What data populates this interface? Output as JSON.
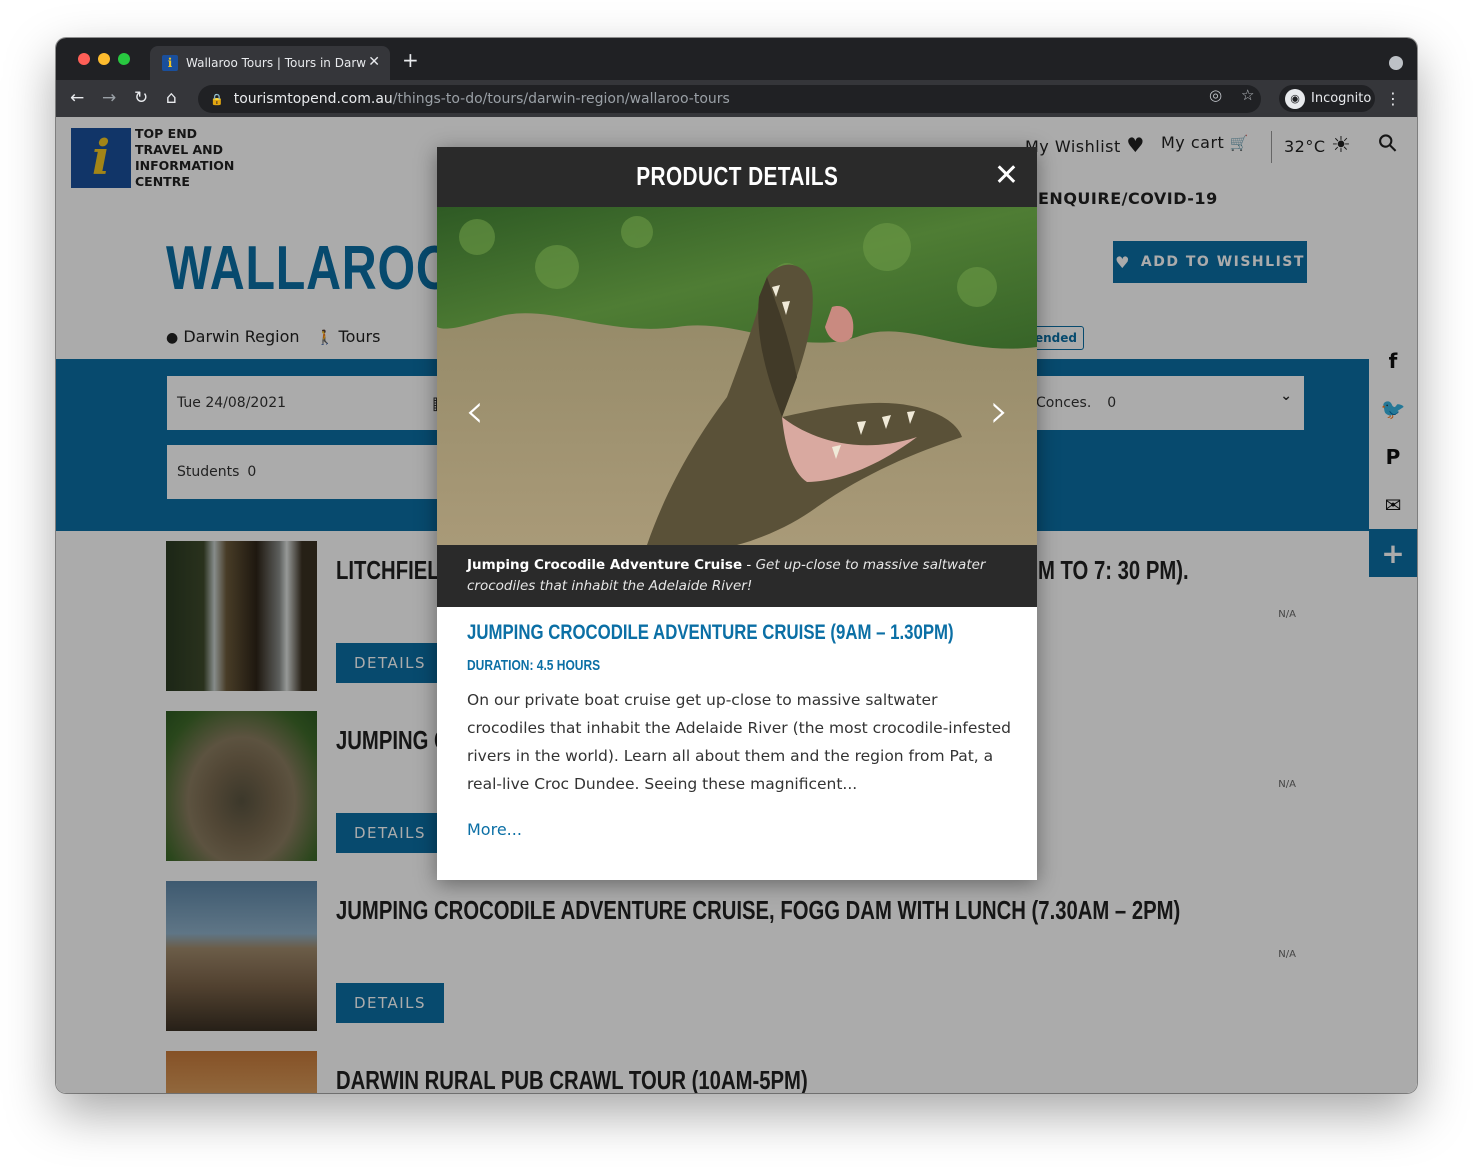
{
  "browser": {
    "tab_title": "Wallaroo Tours | Tours in Darwin",
    "tab_close": "✕",
    "new_tab": "+",
    "url_host": "tourismtopend.com.au",
    "url_path": "/things-to-do/tours/darwin-region/wallaroo-tours",
    "incognito_label": "Incognito"
  },
  "site": {
    "logo_letter": "i",
    "logo_text": "TOP END TRAVEL AND INFORMATION CENTRE",
    "wishlist_link": "My Wishlist",
    "cart_link": "My cart",
    "temperature": "32°C",
    "enquire_link": "ENQUIRE/COVID-19"
  },
  "page": {
    "title": "WALLAROO T",
    "add_to_wishlist": "ADD TO WISHLIST",
    "region": "Darwin Region",
    "category": "Tours",
    "recommended_badge": "ended"
  },
  "booking": {
    "date": "Tue 24/08/2021",
    "concession_label": "Conces.",
    "concession_value": "0",
    "students_label": "Students",
    "students_value": "0"
  },
  "tours": [
    {
      "title": "LITCHFIELD",
      "title_right": "M TO 7: 30 PM).",
      "details": "DETAILS",
      "price": "N/A"
    },
    {
      "title": "JUMPING C",
      "details": "DETAILS",
      "price": "N/A"
    },
    {
      "title": "JUMPING CROCODILE ADVENTURE CRUISE, FOGG DAM WITH LUNCH (7.30AM – 2PM)",
      "details": "DETAILS",
      "price": "N/A"
    },
    {
      "title": "DARWIN RURAL PUB CRAWL TOUR (10AM-5PM)"
    }
  ],
  "modal": {
    "header": "PRODUCT DETAILS",
    "close": "✕",
    "caption_name": "Jumping Crocodile Adventure Cruise",
    "caption_sep": " - ",
    "caption_text": "Get up-close to massive saltwater crocodiles that inhabit the Adelaide River!",
    "product_name": "JUMPING CROCODILE ADVENTURE CRUISE (9AM – 1.30PM)",
    "duration_label": "DURATION:",
    "duration_value": "4.5 HOURS",
    "description": "On our private boat cruise get up-close to massive saltwater crocodiles that inhabit the Adelaide River (the most crocodile-infested rivers in the world). Learn all about them and the region from Pat, a real-live Croc Dundee. Seeing these magnificent...",
    "more_link": "More..."
  },
  "icons": {
    "back": "←",
    "forward": "→",
    "reload": "↻",
    "home": "⌂",
    "lock": "🔒",
    "eye_off": "◎",
    "star": "☆",
    "kebab": "⋮",
    "heart": "♥",
    "cart": "🛒",
    "sun": "☀",
    "search": "⚲",
    "pin": "●",
    "walker": "🚶",
    "calendar": "▦",
    "chevron": "⌄",
    "prev": "‹",
    "next": "›",
    "facebook": "f",
    "twitter": "🐦",
    "pinterest": "P",
    "email": "✉",
    "plus": "+"
  },
  "colors": {
    "brand_blue": "#0b6fa5",
    "logo_blue": "#1a4f9c",
    "logo_yellow": "#f3c623",
    "modal_dark": "#2a2a2a",
    "chrome_dark": "#202124",
    "chrome_mid": "#35363a"
  }
}
